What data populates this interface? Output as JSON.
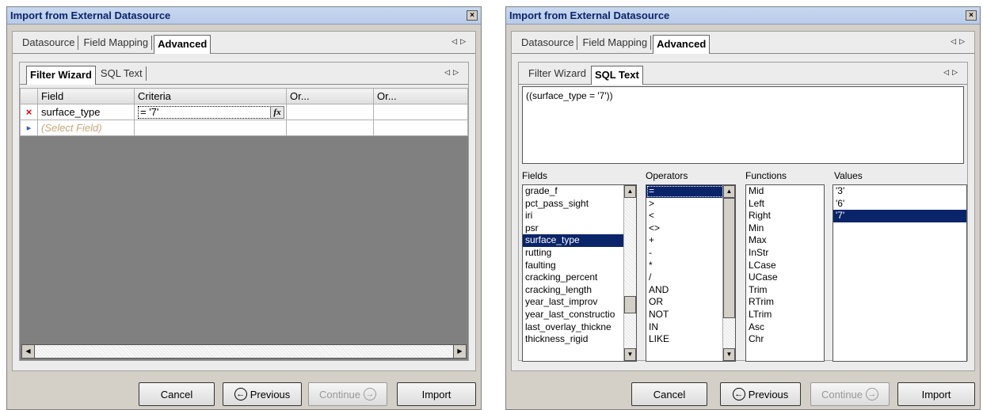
{
  "dialog1": {
    "title": "Import from External Datasource",
    "close_glyph": "×",
    "tabs": [
      "Datasource",
      "Field Mapping",
      "Advanced"
    ],
    "active_tab": "Advanced",
    "subtabs": [
      "Filter Wizard",
      "SQL Text"
    ],
    "active_subtab": "Filter Wizard",
    "grid": {
      "columns": [
        "Field",
        "Criteria",
        "Or...",
        "Or..."
      ],
      "rows": [
        {
          "marker": "×",
          "field": "surface_type",
          "criteria": "= '7'",
          "fx": "fx"
        },
        {
          "marker": "▸",
          "field": "(Select Field)",
          "criteria": ""
        }
      ]
    },
    "buttons": {
      "cancel": "Cancel",
      "previous": "Previous",
      "continue": "Continue",
      "import": "Import"
    }
  },
  "dialog2": {
    "title": "Import from External Datasource",
    "close_glyph": "×",
    "tabs": [
      "Datasource",
      "Field Mapping",
      "Advanced"
    ],
    "active_tab": "Advanced",
    "subtabs": [
      "Filter Wizard",
      "SQL Text"
    ],
    "active_subtab": "SQL Text",
    "sql_text": "((surface_type = '7'))",
    "fields_label": "Fields",
    "operators_label": "Operators",
    "functions_label": "Functions",
    "values_label": "Values",
    "fields": [
      "grade_f",
      "pct_pass_sight",
      "iri",
      "psr",
      "surface_type",
      "rutting",
      "faulting",
      "cracking_percent",
      "cracking_length",
      "year_last_improv",
      "year_last_constructio",
      "last_overlay_thickne",
      "thickness_rigid"
    ],
    "selected_field": "surface_type",
    "operators": [
      "=",
      ">",
      "<",
      "<>",
      "+",
      "-",
      "*",
      "/",
      "AND",
      "OR",
      "NOT",
      "IN",
      "LIKE"
    ],
    "selected_operator": "=",
    "functions": [
      "Mid",
      "Left",
      "Right",
      "Min",
      "Max",
      "InStr",
      "LCase",
      "UCase",
      "Trim",
      "RTrim",
      "LTrim",
      "Asc",
      "Chr"
    ],
    "values": [
      "'3'",
      "'6'",
      "'7'"
    ],
    "selected_value": "'7'",
    "buttons": {
      "cancel": "Cancel",
      "previous": "Previous",
      "continue": "Continue",
      "import": "Import"
    }
  },
  "icons": {
    "prev_arrow": "◁",
    "next_arrow": "▷",
    "circle_left": "←",
    "circle_right": "→",
    "up": "▲",
    "down": "▼",
    "left": "◀",
    "right": "▶"
  }
}
